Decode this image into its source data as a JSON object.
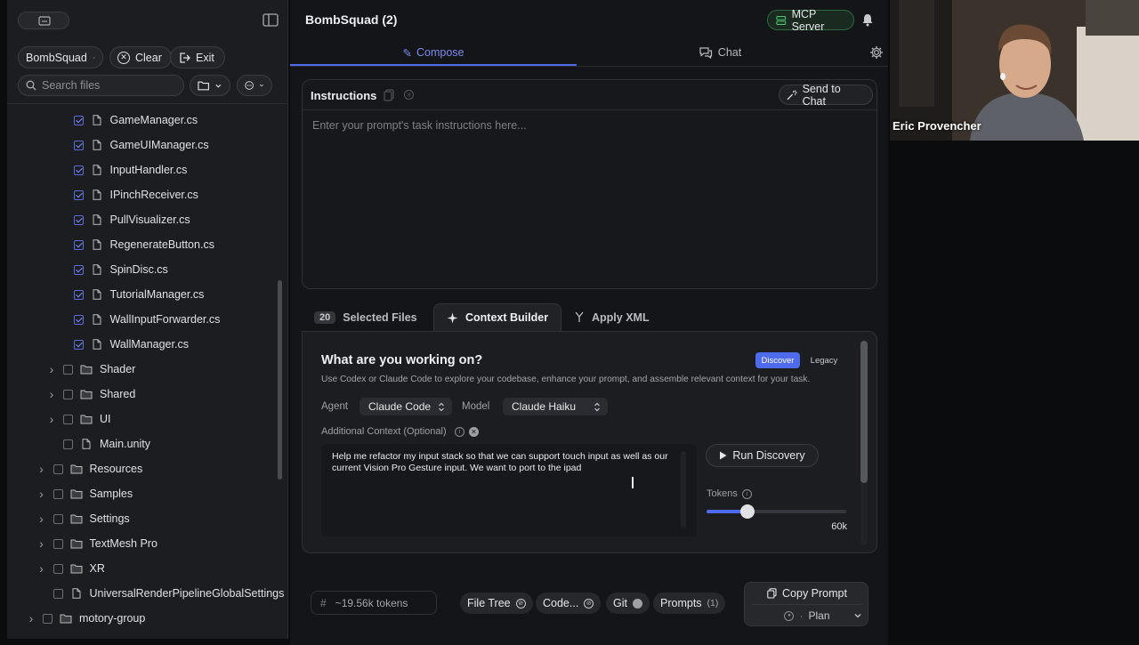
{
  "sidebar": {
    "workspace_label": "BombSquad",
    "clear_label": "Clear",
    "exit_label": "Exit",
    "search_placeholder": "Search files",
    "tree": [
      {
        "label": "GameManager.cs",
        "type": "file",
        "checked": true
      },
      {
        "label": "GameUIManager.cs",
        "type": "file",
        "checked": true
      },
      {
        "label": "InputHandler.cs",
        "type": "file",
        "checked": true
      },
      {
        "label": "IPinchReceiver.cs",
        "type": "file",
        "checked": true
      },
      {
        "label": "PullVisualizer.cs",
        "type": "file",
        "checked": true
      },
      {
        "label": "RegenerateButton.cs",
        "type": "file",
        "checked": true
      },
      {
        "label": "SpinDisc.cs",
        "type": "file",
        "checked": true
      },
      {
        "label": "TutorialManager.cs",
        "type": "file",
        "checked": true
      },
      {
        "label": "WallInputForwarder.cs",
        "type": "file",
        "checked": true
      },
      {
        "label": "WallManager.cs",
        "type": "file",
        "checked": true
      },
      {
        "label": "Shader",
        "type": "folder",
        "checked": false
      },
      {
        "label": "Shared",
        "type": "folder",
        "checked": false
      },
      {
        "label": "UI",
        "type": "folder",
        "checked": false
      },
      {
        "label": "Main.unity",
        "type": "file",
        "checked": false
      },
      {
        "label": "Resources",
        "type": "folder",
        "checked": false
      },
      {
        "label": "Samples",
        "type": "folder",
        "checked": false
      },
      {
        "label": "Settings",
        "type": "folder",
        "checked": false
      },
      {
        "label": "TextMesh Pro",
        "type": "folder",
        "checked": false
      },
      {
        "label": "XR",
        "type": "folder",
        "checked": false
      },
      {
        "label": "UniversalRenderPipelineGlobalSettings",
        "type": "file",
        "checked": false
      },
      {
        "label": "motory-group",
        "type": "folder",
        "checked": false
      }
    ]
  },
  "header": {
    "title": "BombSquad (2)",
    "mcp_label": "MCP Server"
  },
  "tabs": {
    "compose": "Compose",
    "chat": "Chat"
  },
  "instructions": {
    "title": "Instructions",
    "send_label": "Send to Chat",
    "placeholder": "Enter your prompt's task instructions here..."
  },
  "context_tabs": {
    "selected_count": "20",
    "selected_label": "Selected Files",
    "builder_label": "Context Builder",
    "apply_label": "Apply XML"
  },
  "builder": {
    "heading": "What are you working on?",
    "mode_discover": "Discover",
    "mode_legacy": "Legacy",
    "description": "Use Codex or Claude Code to explore your codebase, enhance your prompt, and assemble relevant context for your task.",
    "agent_label": "Agent",
    "agent_value": "Claude Code",
    "model_label": "Model",
    "model_value": "Claude Haiku",
    "additional_label": "Additional Context (Optional)",
    "additional_text": "Help me refactor my input stack so that we can support touch input as well as our current Vision Pro Gesture input. We want to port to the ipad",
    "run_label": "Run Discovery",
    "tokens_label": "Tokens",
    "tokens_value": "60k",
    "tokens_fraction": 0.29
  },
  "footer": {
    "tokens_estimate": "~19.56k tokens",
    "chip_file_tree": "File Tree",
    "chip_code": "Code...",
    "chip_git": "Git",
    "chip_prompts": "Prompts",
    "chip_prompts_count": "(1)",
    "copy_label": "Copy Prompt",
    "plan_label": "Plan"
  },
  "webcam": {
    "name": "Eric Provencher"
  },
  "colors": {
    "accent": "#4f6bed",
    "compose_tab": "#7b8cf0",
    "background": "#141518"
  }
}
